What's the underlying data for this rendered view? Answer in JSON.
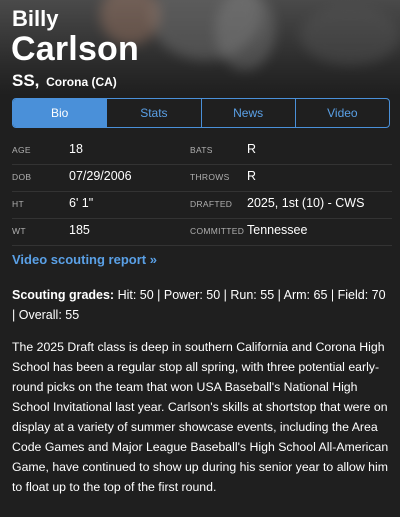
{
  "player": {
    "first_name": "Billy",
    "last_name": "Carlson",
    "position": "SS,",
    "location": "Corona (CA)"
  },
  "tabs": [
    {
      "label": "Bio",
      "active": true
    },
    {
      "label": "Stats",
      "active": false
    },
    {
      "label": "News",
      "active": false
    },
    {
      "label": "Video",
      "active": false
    }
  ],
  "info": {
    "age_label": "AGE",
    "age": "18",
    "bats_label": "BATS",
    "bats": "R",
    "dob_label": "DOB",
    "dob": "07/29/2006",
    "throws_label": "THROWS",
    "throws": "R",
    "ht_label": "HT",
    "ht": "6' 1\"",
    "drafted_label": "DRAFTED",
    "drafted": "2025, 1st (10) - CWS",
    "wt_label": "WT",
    "wt": "185",
    "committed_label": "COMMITTED",
    "committed": "Tennessee"
  },
  "video_link": "Video scouting report »",
  "scouting": {
    "heading": "Scouting grades:",
    "grades": " Hit: 50 | Power: 50 | Run: 55 | Arm: 65 | Field: 70 | Overall: 55"
  },
  "story": "The 2025 Draft class is deep in southern California and Corona High School has been a regular stop all spring, with three potential early-round picks on the team that won USA Baseball's National High School Invitational last year. Carlson's skills at shortstop that were on display at a variety of summer showcase events, including the Area Code Games and Major League Baseball's High School All-American Game, have continued to show up during his senior year to allow him to float up to the top of the first round.",
  "colors": {
    "background": "#1f1f1f",
    "accent": "#4a90d9",
    "link": "#5aa0e6"
  }
}
